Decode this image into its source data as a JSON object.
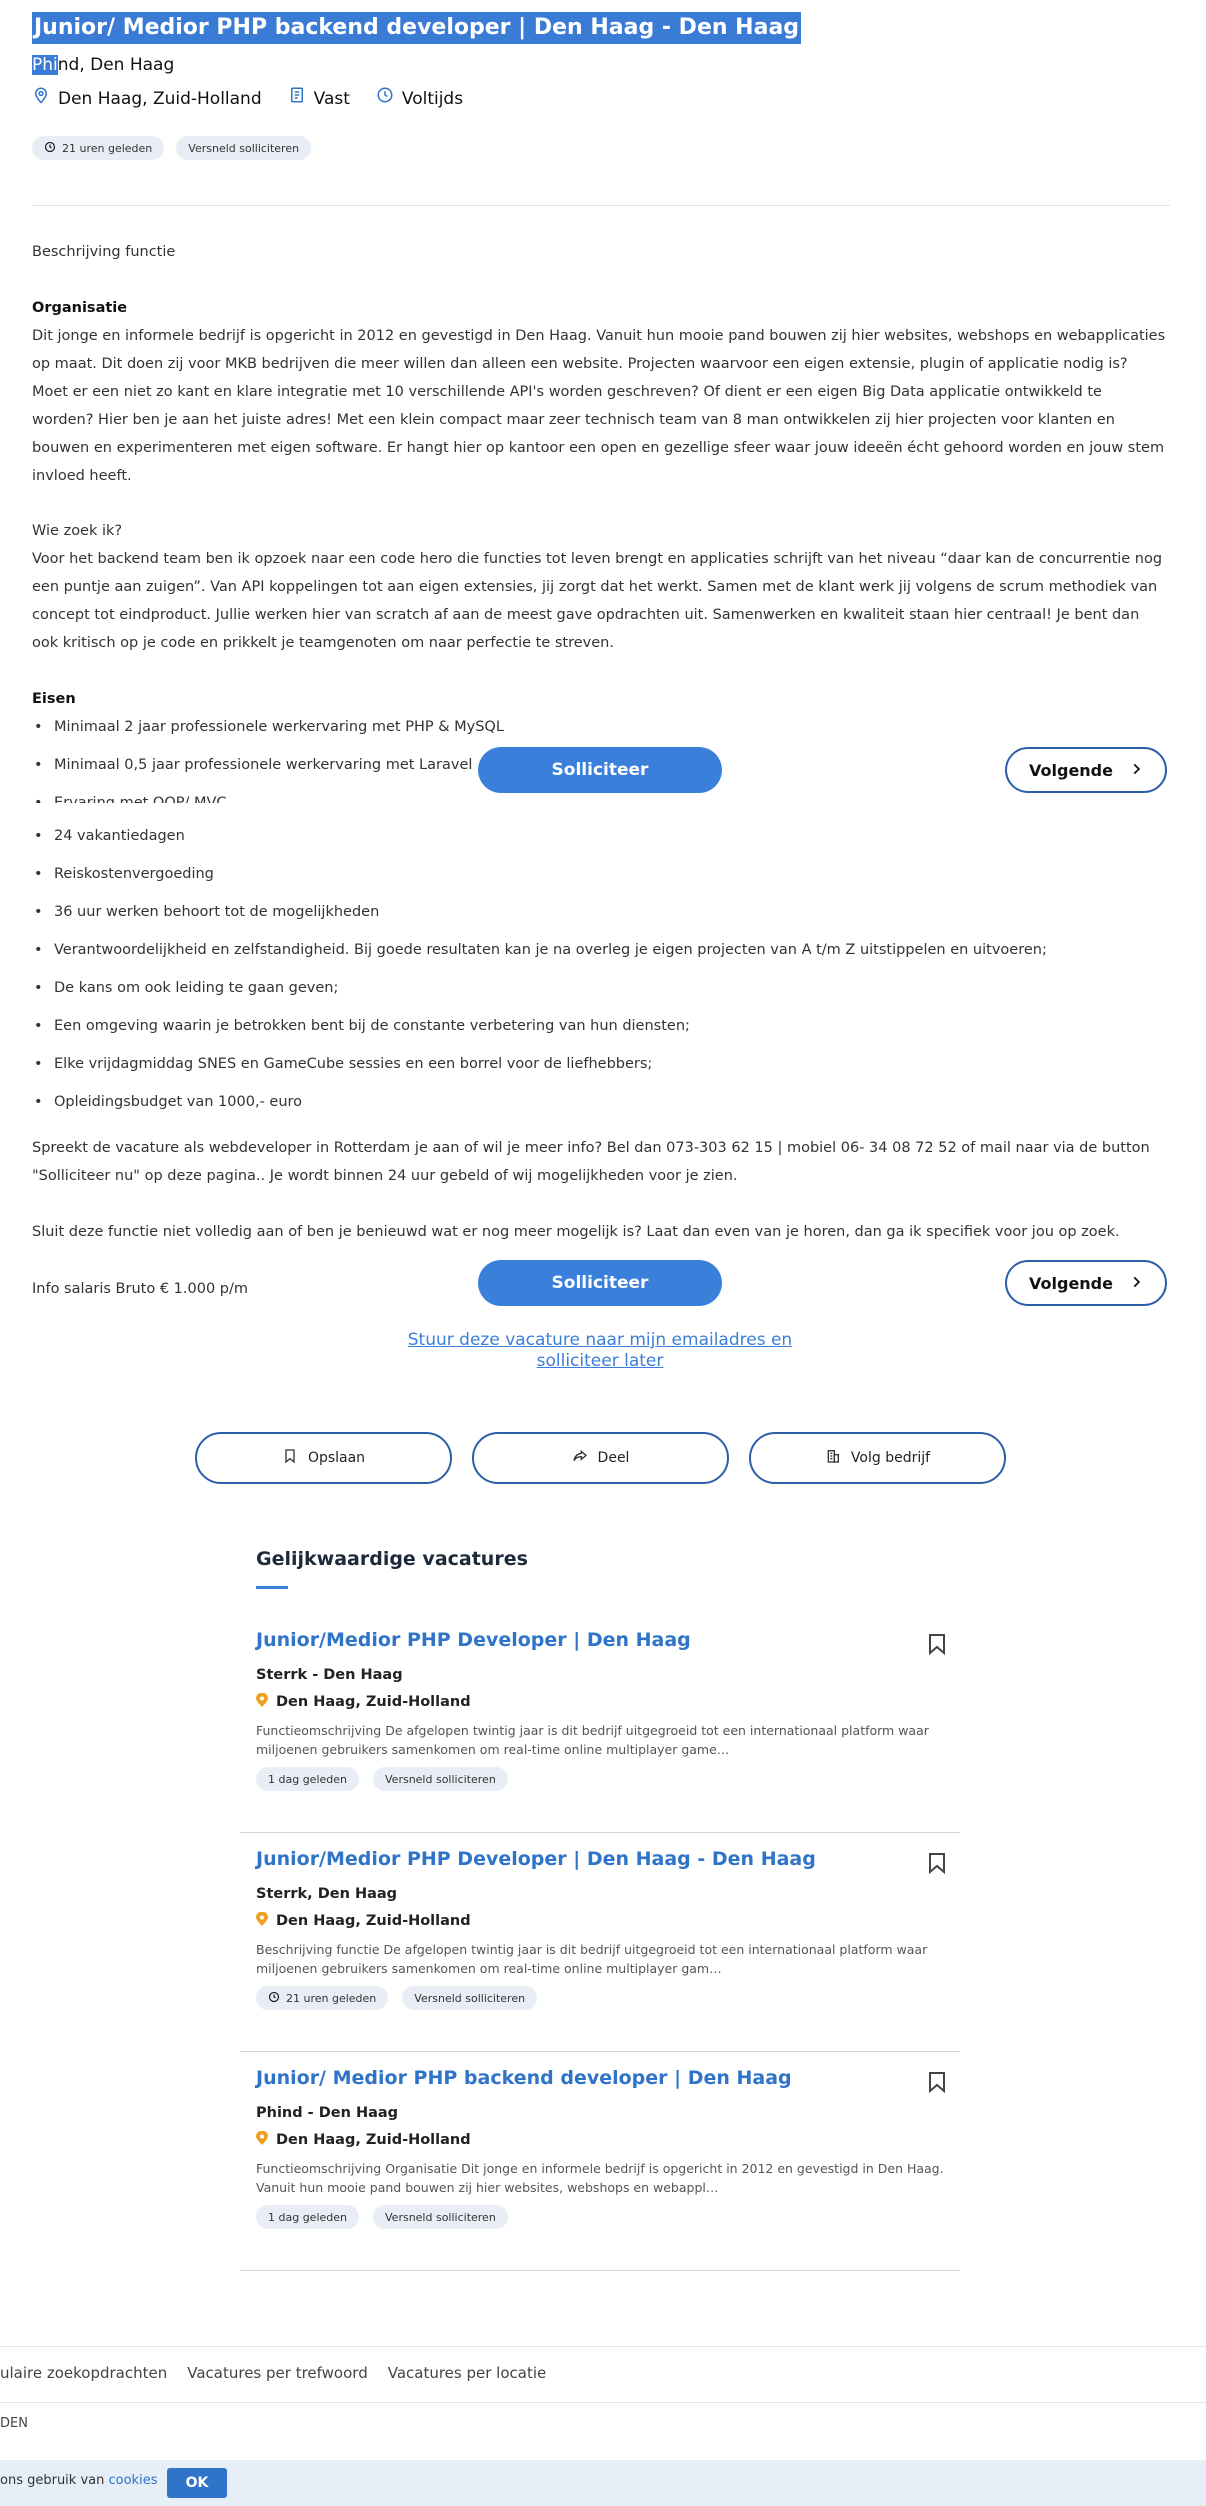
{
  "job": {
    "title": "Junior/ Medior PHP backend developer | Den Haag - Den Haag",
    "company_selected": "Phi",
    "company_rest": "nd, Den Haag",
    "location": "Den Haag, Zuid-Holland",
    "contract": "Vast",
    "hours": "Voltijds",
    "chips": [
      "21 uren geleden",
      "Versneld solliciteren"
    ]
  },
  "description": {
    "heading": "Beschrijving functie",
    "org_heading": "Organisatie",
    "org_text": "Dit jonge en informele bedrijf is opgericht in 2012 en gevestigd in Den Haag. Vanuit hun mooie pand bouwen zij hier websites, webshops en webapplicaties op maat. Dit doen zij voor MKB bedrijven die meer willen dan alleen een website. Projecten waarvoor een eigen extensie, plugin of applicatie nodig is? Moet er een niet zo kant en klare integratie met 10 verschillende API's worden geschreven? Of dient er een eigen Big Data applicatie ontwikkeld te worden? Hier ben je aan het juiste adres! Met een klein compact maar zeer technisch team van 8 man ontwikkelen zij hier projecten voor klanten en bouwen en experimenteren met eigen software. Er hangt hier op kantoor een open en gezellige sfeer waar jouw ideeën écht gehoord worden en jouw stem invloed heeft.",
    "who_heading": "Wie zoek ik?",
    "who_text": "Voor het backend team ben ik opzoek naar een code hero die functies tot leven brengt en applicaties schrijft van het niveau “daar kan de concurrentie nog een puntje aan zuigen”. Van API koppelingen tot aan eigen extensies, jij zorgt dat het werkt. Samen met de klant werk jij volgens de scrum methodiek van concept tot eindproduct. Jullie werken hier van scratch af aan de meest gave opdrachten uit. Samenwerken en kwaliteit staan hier centraal! Je bent dan ook kritisch op je code en prikkelt je teamgenoten om naar perfectie te streven.",
    "req_heading": "Eisen",
    "requirements": [
      "Minimaal 2 jaar professionele werkervaring met PHP & MySQL",
      "Minimaal 0,5 jaar professionele werkervaring met Laravel",
      "Ervaring met OOP/ MVC"
    ],
    "benefits": [
      "24 vakantiedagen",
      "Reiskostenvergoeding",
      "36 uur werken behoort tot de mogelijkheden",
      "Verantwoordelijkheid en zelfstandigheid. Bij goede resultaten kan je na overleg je eigen projecten van A t/m Z uitstippelen en uitvoeren;",
      "De kans om ook leiding te gaan geven;",
      "Een omgeving waarin je betrokken bent bij de constante verbetering van hun diensten;",
      "Elke vrijdagmiddag SNES en GameCube sessies en een borrel voor de liefhebbers;",
      "Opleidingsbudget van 1000,- euro"
    ],
    "contact_text": "Spreekt de vacature als webdeveloper in Rotterdam je aan of wil je meer info? Bel dan 073-303 62 15 | mobiel 06- 34 08 72 52 of mail naar via de button \"Solliciteer nu\" op deze pagina.. Je wordt binnen 24 uur gebeld of wij mogelijkheden voor je zien.",
    "closing_text": "Sluit deze functie niet volledig aan of ben je benieuwd wat er nog meer mogelijk is? Laat dan even van je horen, dan ga ik specifiek voor jou op zoek.",
    "salary": "Info salaris Bruto € 1.000 p/m"
  },
  "actions": {
    "apply": "Solliciteer",
    "next": "Volgende",
    "email_link": "Stuur deze vacature naar mijn emailadres en solliciteer later",
    "save": "Opslaan",
    "share": "Deel",
    "follow": "Volg bedrijf"
  },
  "similar": {
    "heading": "Gelijkwaardige vacatures",
    "items": [
      {
        "title": "Junior/Medior PHP Developer | Den Haag",
        "company": "Sterrk - Den Haag",
        "location": "Den Haag, Zuid-Holland",
        "desc": "Functieomschrijving De afgelopen twintig jaar is dit bedrijf uitgegroeid tot een internationaal platform waar miljoenen gebruikers samenkomen om real-time online multiplayer game…",
        "chips": [
          "1 dag geleden",
          "Versneld solliciteren"
        ]
      },
      {
        "title": "Junior/Medior PHP Developer | Den Haag - Den Haag",
        "company": "Sterrk, Den Haag",
        "location": "Den Haag, Zuid-Holland",
        "desc": "Beschrijving functie De afgelopen twintig jaar is dit bedrijf uitgegroeid tot een internationaal platform waar miljoenen gebruikers samenkomen om real-time online multiplayer gam…",
        "chips": [
          "21 uren geleden",
          "Versneld solliciteren"
        ]
      },
      {
        "title": "Junior/ Medior PHP backend developer | Den Haag",
        "company": "Phind - Den Haag",
        "location": "Den Haag, Zuid-Holland",
        "desc": "Functieomschrijving Organisatie Dit jonge en informele bedrijf is opgericht in 2012 en gevestigd in Den Haag. Vanuit hun mooie pand bouwen zij hier websites, webshops en webappl…",
        "chips": [
          "1 dag geleden",
          "Versneld solliciteren"
        ]
      }
    ]
  },
  "footer": {
    "links": [
      "ulaire zoekopdrachten",
      "Vacatures per trefwoord",
      "Vacatures per locatie"
    ],
    "den": "DEN",
    "cookie_prefix": "ons gebruik van ",
    "cookie_link": "cookies",
    "ok": "OK"
  },
  "colors": {
    "accent": "#3a7fd9",
    "link": "#2f74c9",
    "chip_bg": "#e9eef6",
    "cookie_bg": "#e6eef8"
  }
}
